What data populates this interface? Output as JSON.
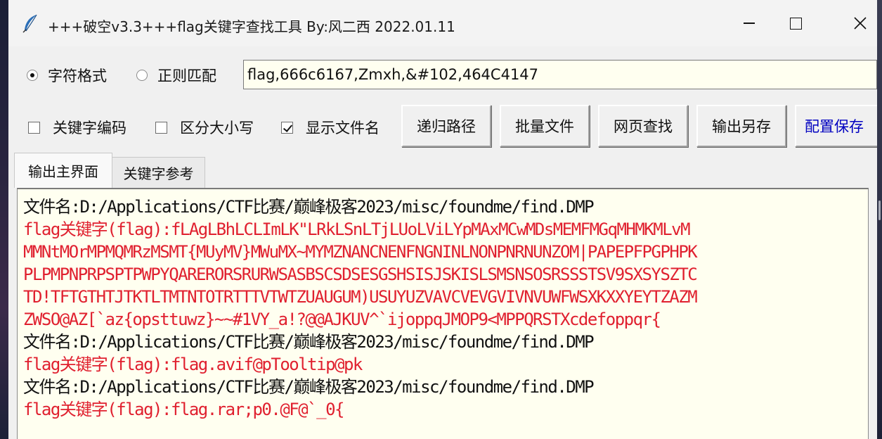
{
  "window": {
    "title": "+++破空v3.3+++flag关键字查找工具  By:风二西 2022.01.11",
    "icon": "feather-icon"
  },
  "search": {
    "mode_options": [
      {
        "label": "字符格式",
        "selected": true
      },
      {
        "label": "正则匹配",
        "selected": false
      }
    ],
    "keywords_value": "flag,666c6167,Zmxh,&#102,464C4147"
  },
  "options": {
    "checkboxes": [
      {
        "label": "关键字编码",
        "checked": false
      },
      {
        "label": "区分大小写",
        "checked": false
      },
      {
        "label": "显示文件名",
        "checked": true
      }
    ],
    "buttons": [
      {
        "label": "递归路径"
      },
      {
        "label": "批量文件"
      },
      {
        "label": "网页查找"
      },
      {
        "label": "输出另存"
      },
      {
        "label": "配置保存"
      }
    ]
  },
  "tabs": [
    {
      "label": "输出主界面",
      "active": true
    },
    {
      "label": "关键字参考",
      "active": false
    }
  ],
  "output": {
    "lines": [
      {
        "kind": "file",
        "text": "文件名:D:/Applications/CTF比赛/巅峰极客2023/misc/foundme/find.DMP"
      },
      {
        "kind": "flag",
        "text": "flag关键字(flag):fLAgLBhLCLImLK\"LRkLSnLTjLUoLViLYpMAxMCwMDsMEMFMGqMHMKMLvM"
      },
      {
        "kind": "flag",
        "text": "MMNtMOrMPMQMRzMSMT{MUyMV}MWuMX~MYMZNANCNENFNGNINLNONPNRNUNZOM|PAPEPFPGPHPK"
      },
      {
        "kind": "flag",
        "text": "PLPMPNPRPSPTPWPYQARERORSRURWSASBSCSDSESGSHSISJSKISLSMSNSOSRSSSTSV9SXSYSZTC"
      },
      {
        "kind": "flag",
        "text": "TD!TFTGTHTJTKTLTMTNTOTRTTTVTWTZUAUGUM)USUYUZVAVCVEVGVIVNVUWFWSXKXXYEYTZAZM"
      },
      {
        "kind": "flag",
        "text": "ZWSO@AZ[`az{opsttuwz}~~#1VY_a!?@@AJKUV^`ijoppqJMOP9<MPPQRSTXcdefoppqr{"
      },
      {
        "kind": "file",
        "text": "文件名:D:/Applications/CTF比赛/巅峰极客2023/misc/foundme/find.DMP"
      },
      {
        "kind": "flag",
        "text": "flag关键字(flag):flag.avif@pTooltip@pk"
      },
      {
        "kind": "file",
        "text": "文件名:D:/Applications/CTF比赛/巅峰极客2023/misc/foundme/find.DMP"
      },
      {
        "kind": "flag",
        "text": "flag关键字(flag):flag.rar;p0.@F@`_0{"
      }
    ]
  },
  "colors": {
    "file_line": "#111111",
    "flag_line": "#e0202f",
    "output_bg": "#fffff0",
    "accent_button_text": "#0000c0"
  }
}
